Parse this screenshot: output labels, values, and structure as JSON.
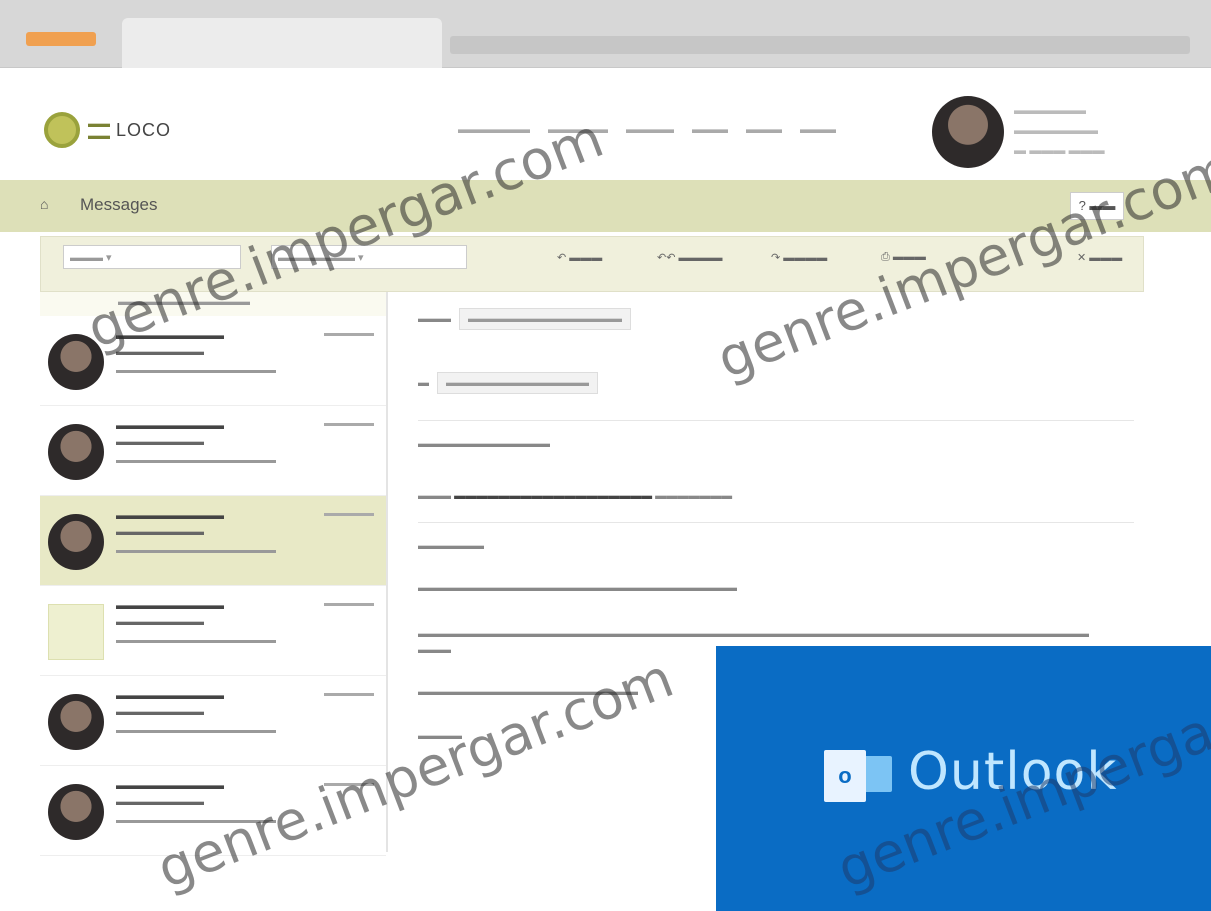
{
  "header": {
    "logo_text": "LOCO"
  },
  "title_bar": {
    "title": "Messages"
  },
  "outlook": {
    "brand_text": "Outlook",
    "icon_letter": "o"
  },
  "watermarks": [
    "genre.impergar.com",
    "genre.impergar.com",
    "genre.impergar.com",
    "genre.impergar.com"
  ],
  "colors": {
    "accent": "#dde0b8",
    "outlook_blue": "#0a6cc4"
  }
}
